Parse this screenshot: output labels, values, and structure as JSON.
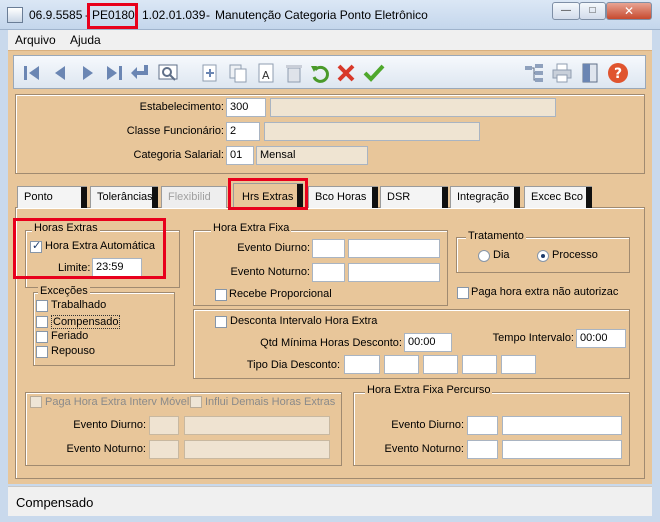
{
  "window": {
    "version": "06.9.5585",
    "program": "PE0180",
    "build": "1.02.01.039",
    "title": "Manutenção Categoria Ponto Eletrônico",
    "min_glyph": "—",
    "max_glyph": "□",
    "close_glyph": "✕"
  },
  "menu": {
    "arquivo": "Arquivo",
    "ajuda": "Ajuda"
  },
  "toolbar": {
    "icons": [
      "first-icon",
      "prev-icon",
      "next-icon",
      "last-icon",
      "goto-icon",
      "zoom-icon",
      "new-icon",
      "copy-icon",
      "edit-icon",
      "delete-icon",
      "undo-icon",
      "cancel-icon",
      "save-icon",
      "tree-icon",
      "print-icon",
      "exit-icon",
      "help-icon"
    ]
  },
  "header": {
    "estabelecimento_label": "Estabelecimento:",
    "estabelecimento_code": "300",
    "estabelecimento_desc": "",
    "classe_label": "Classe Funcionário:",
    "classe_code": "2",
    "classe_desc": "",
    "categoria_label": "Categoria Salarial:",
    "categoria_code": "01",
    "categoria_desc": "Mensal"
  },
  "tabs": {
    "ponto": "Ponto",
    "tolerancias": "Tolerâncias",
    "flexibilid": "Flexibilid",
    "hrs_extras": "Hrs Extras",
    "bco_horas": "Bco Horas",
    "dsr": "DSR",
    "integracao": "Integração",
    "exec_bco": "Excec Bco"
  },
  "horas_extras": {
    "title": "Horas Extras",
    "automatica_label": "Hora Extra Automática",
    "automatica_checked": true,
    "limite_label": "Limite:",
    "limite_value": "23:59"
  },
  "excecoes": {
    "title": "Exceções",
    "trabalhado": "Trabalhado",
    "compensado": "Compensado",
    "feriado": "Feriado",
    "repouso": "Repouso"
  },
  "hora_extra_fixa": {
    "title": "Hora Extra Fixa",
    "diurno_label": "Evento Diurno:",
    "noturno_label": "Evento Noturno:",
    "proporcional_label": "Recebe Proporcional"
  },
  "tratamento": {
    "title": "Tratamento",
    "dia": "Dia",
    "processo": "Processo",
    "selected": "Processo"
  },
  "paga_nao_autorizada": "Paga hora extra não autorizac",
  "intervalo": {
    "desconta_label": "Desconta Intervalo Hora Extra",
    "qtd_label": "Qtd Mínima Horas Desconto:",
    "qtd_value": "00:00",
    "tempo_label": "Tempo Intervalo:",
    "tempo_value": "00:00",
    "tipo_label": "Tipo Dia Desconto:"
  },
  "interv_movel": {
    "paga_label": "Paga Hora Extra Interv Móvel",
    "influi_label": "Influi Demais Horas Extras",
    "diurno_label": "Evento Diurno:",
    "noturno_label": "Evento Noturno:"
  },
  "percurso": {
    "title": "Hora Extra Fixa Percurso",
    "diurno_label": "Evento Diurno:",
    "noturno_label": "Evento Noturno:"
  },
  "status": {
    "text": "Compensado"
  },
  "colors": {
    "panel": "#e8c69a",
    "highlight": "#e8001c",
    "chrome": "#c9d9ec"
  }
}
